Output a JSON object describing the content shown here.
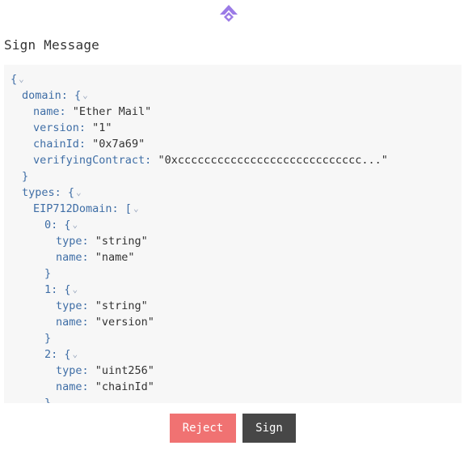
{
  "header": {
    "logo_icon": "app-logo-icon",
    "accent_color": "#9b7be6"
  },
  "title": "Sign Message",
  "message_lines": [
    {
      "depth": 0,
      "parts": [
        {
          "t": "{",
          "c": "punc"
        }
      ],
      "chevron": true
    },
    {
      "depth": 1,
      "parts": [
        {
          "t": "domain",
          "c": "key"
        },
        {
          "t": ": {",
          "c": "punc"
        }
      ],
      "chevron": true
    },
    {
      "depth": 2,
      "parts": [
        {
          "t": "name",
          "c": "key"
        },
        {
          "t": ": ",
          "c": "punc"
        },
        {
          "t": "\"Ether Mail\"",
          "c": "str"
        }
      ],
      "chevron": false
    },
    {
      "depth": 2,
      "parts": [
        {
          "t": "version",
          "c": "key"
        },
        {
          "t": ": ",
          "c": "punc"
        },
        {
          "t": "\"1\"",
          "c": "str"
        }
      ],
      "chevron": false
    },
    {
      "depth": 2,
      "parts": [
        {
          "t": "chainId",
          "c": "key"
        },
        {
          "t": ": ",
          "c": "punc"
        },
        {
          "t": "\"0x7a69\"",
          "c": "str"
        }
      ],
      "chevron": false
    },
    {
      "depth": 2,
      "parts": [
        {
          "t": "verifyingContract",
          "c": "key"
        },
        {
          "t": ": ",
          "c": "punc"
        },
        {
          "t": "\"0xcccccccccccccccccccccccccccc...\"",
          "c": "str"
        }
      ],
      "chevron": false
    },
    {
      "depth": 1,
      "parts": [
        {
          "t": "}",
          "c": "punc"
        }
      ],
      "chevron": false
    },
    {
      "depth": 1,
      "parts": [
        {
          "t": "types",
          "c": "key"
        },
        {
          "t": ": {",
          "c": "punc"
        }
      ],
      "chevron": true
    },
    {
      "depth": 2,
      "parts": [
        {
          "t": "EIP712Domain",
          "c": "key"
        },
        {
          "t": ": [",
          "c": "punc"
        }
      ],
      "chevron": true
    },
    {
      "depth": 3,
      "parts": [
        {
          "t": "0",
          "c": "key"
        },
        {
          "t": ": {",
          "c": "punc"
        }
      ],
      "chevron": true
    },
    {
      "depth": 4,
      "parts": [
        {
          "t": "type",
          "c": "key"
        },
        {
          "t": ": ",
          "c": "punc"
        },
        {
          "t": "\"string\"",
          "c": "str"
        }
      ],
      "chevron": false
    },
    {
      "depth": 4,
      "parts": [
        {
          "t": "name",
          "c": "key"
        },
        {
          "t": ": ",
          "c": "punc"
        },
        {
          "t": "\"name\"",
          "c": "str"
        }
      ],
      "chevron": false
    },
    {
      "depth": 3,
      "parts": [
        {
          "t": "}",
          "c": "punc"
        }
      ],
      "chevron": false
    },
    {
      "depth": 3,
      "parts": [
        {
          "t": "1",
          "c": "key"
        },
        {
          "t": ": {",
          "c": "punc"
        }
      ],
      "chevron": true
    },
    {
      "depth": 4,
      "parts": [
        {
          "t": "type",
          "c": "key"
        },
        {
          "t": ": ",
          "c": "punc"
        },
        {
          "t": "\"string\"",
          "c": "str"
        }
      ],
      "chevron": false
    },
    {
      "depth": 4,
      "parts": [
        {
          "t": "name",
          "c": "key"
        },
        {
          "t": ": ",
          "c": "punc"
        },
        {
          "t": "\"version\"",
          "c": "str"
        }
      ],
      "chevron": false
    },
    {
      "depth": 3,
      "parts": [
        {
          "t": "}",
          "c": "punc"
        }
      ],
      "chevron": false
    },
    {
      "depth": 3,
      "parts": [
        {
          "t": "2",
          "c": "key"
        },
        {
          "t": ": {",
          "c": "punc"
        }
      ],
      "chevron": true
    },
    {
      "depth": 4,
      "parts": [
        {
          "t": "type",
          "c": "key"
        },
        {
          "t": ": ",
          "c": "punc"
        },
        {
          "t": "\"uint256\"",
          "c": "str"
        }
      ],
      "chevron": false
    },
    {
      "depth": 4,
      "parts": [
        {
          "t": "name",
          "c": "key"
        },
        {
          "t": ": ",
          "c": "punc"
        },
        {
          "t": "\"chainId\"",
          "c": "str"
        }
      ],
      "chevron": false
    },
    {
      "depth": 3,
      "parts": [
        {
          "t": "}",
          "c": "punc"
        }
      ],
      "chevron": false
    }
  ],
  "actions": {
    "reject_label": "Reject",
    "sign_label": "Sign",
    "reject_color": "#f07272",
    "sign_color": "#474747"
  }
}
